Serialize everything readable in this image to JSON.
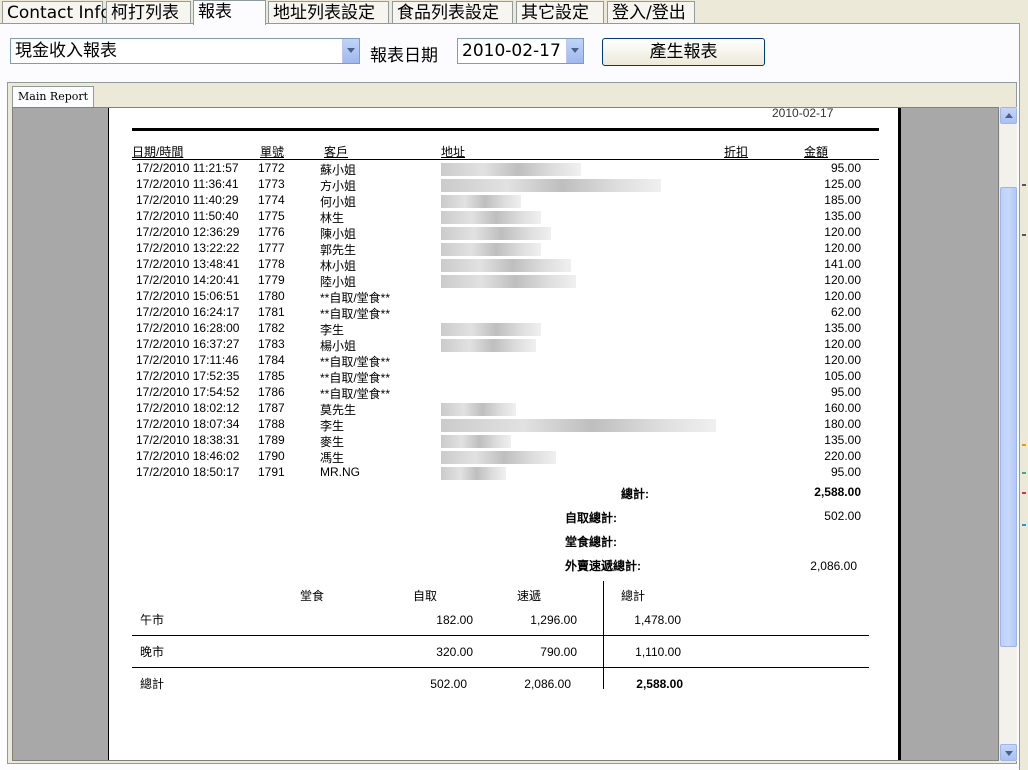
{
  "tabs": [
    "Contact Info",
    "柯打列表",
    "報表",
    "地址列表設定",
    "食品列表設定",
    "其它設定",
    "登入/登出"
  ],
  "active_tab": "報表",
  "controls": {
    "report_type": "現金收入報表",
    "date_label": "報表日期",
    "date_value": "2010-02-17",
    "generate_label": "產生報表"
  },
  "viewer_tab": "Main Report",
  "report": {
    "top_date": "2010-02-17",
    "headers": {
      "datetime": "日期/時間",
      "no": "單號",
      "customer": "客戶",
      "address": "地址",
      "discount": "折扣",
      "amount": "金額"
    },
    "rows": [
      {
        "datetime": "17/2/2010 11:21:57",
        "no": "1772",
        "customer": "蘇小姐",
        "amount": "95.00"
      },
      {
        "datetime": "17/2/2010 11:36:41",
        "no": "1773",
        "customer": "方小姐",
        "amount": "125.00"
      },
      {
        "datetime": "17/2/2010 11:40:29",
        "no": "1774",
        "customer": "何小姐",
        "amount": "185.00"
      },
      {
        "datetime": "17/2/2010 11:50:40",
        "no": "1775",
        "customer": "林生",
        "amount": "135.00"
      },
      {
        "datetime": "17/2/2010 12:36:29",
        "no": "1776",
        "customer": "陳小姐",
        "amount": "120.00"
      },
      {
        "datetime": "17/2/2010 13:22:22",
        "no": "1777",
        "customer": "郭先生",
        "amount": "120.00"
      },
      {
        "datetime": "17/2/2010 13:48:41",
        "no": "1778",
        "customer": "林小姐",
        "amount": "141.00"
      },
      {
        "datetime": "17/2/2010 14:20:41",
        "no": "1779",
        "customer": "陸小姐",
        "amount": "120.00"
      },
      {
        "datetime": "17/2/2010 15:06:51",
        "no": "1780",
        "customer": "**自取/堂食**",
        "amount": "120.00"
      },
      {
        "datetime": "17/2/2010 16:24:17",
        "no": "1781",
        "customer": "**自取/堂食**",
        "amount": "62.00"
      },
      {
        "datetime": "17/2/2010 16:28:00",
        "no": "1782",
        "customer": "李生",
        "amount": "135.00"
      },
      {
        "datetime": "17/2/2010 16:37:27",
        "no": "1783",
        "customer": "楊小姐",
        "amount": "120.00"
      },
      {
        "datetime": "17/2/2010 17:11:46",
        "no": "1784",
        "customer": "**自取/堂食**",
        "amount": "120.00"
      },
      {
        "datetime": "17/2/2010 17:52:35",
        "no": "1785",
        "customer": "**自取/堂食**",
        "amount": "105.00"
      },
      {
        "datetime": "17/2/2010 17:54:52",
        "no": "1786",
        "customer": "**自取/堂食**",
        "amount": "95.00"
      },
      {
        "datetime": "17/2/2010 18:02:12",
        "no": "1787",
        "customer": "莫先生",
        "amount": "160.00"
      },
      {
        "datetime": "17/2/2010 18:07:34",
        "no": "1788",
        "customer": "李生",
        "amount": "180.00"
      },
      {
        "datetime": "17/2/2010 18:38:31",
        "no": "1789",
        "customer": "麥生",
        "amount": "135.00"
      },
      {
        "datetime": "17/2/2010 18:46:02",
        "no": "1790",
        "customer": "馮生",
        "amount": "220.00"
      },
      {
        "datetime": "17/2/2010 18:50:17",
        "no": "1791",
        "customer": "MR.NG",
        "amount": "95.00"
      }
    ],
    "totals": {
      "total_label": "總計:",
      "total_value": "2,588.00",
      "pickup_label": "自取總計:",
      "pickup_value": "502.00",
      "dinein_label": "堂食總計:",
      "dinein_value": "",
      "delivery_label": "外賣速遞總計:",
      "delivery_value": "2,086.00"
    },
    "summary": {
      "col_headers": [
        "堂食",
        "自取",
        "速遞",
        "總計"
      ],
      "rows": [
        {
          "label": "午市",
          "dinein": "",
          "pickup": "182.00",
          "delivery": "1,296.00",
          "total": "1,478.00"
        },
        {
          "label": "晚市",
          "dinein": "",
          "pickup": "320.00",
          "delivery": "790.00",
          "total": "1,110.00"
        },
        {
          "label": "總計",
          "dinein": "",
          "pickup": "502.00",
          "delivery": "2,086.00",
          "total": "2,588.00"
        }
      ]
    }
  }
}
